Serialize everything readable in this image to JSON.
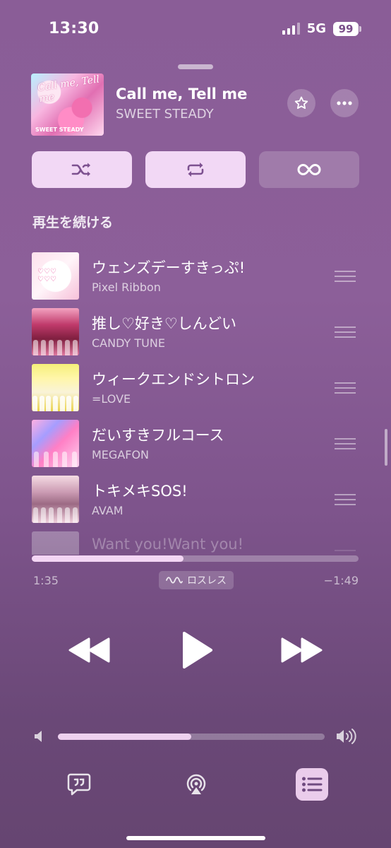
{
  "status_bar": {
    "time": "13:30",
    "network": "5G",
    "battery": "99"
  },
  "now_playing": {
    "title": "Call me, Tell me",
    "artist": "SWEET STEADY",
    "artwork_text": "Call me, Tell me",
    "artwork_subtext": "SWEET STEADY",
    "favorite_icon": "star-icon",
    "more_icon": "ellipsis-icon"
  },
  "modes": [
    {
      "name": "shuffle",
      "icon": "shuffle-icon",
      "active": true
    },
    {
      "name": "repeat",
      "icon": "repeat-icon",
      "active": true
    },
    {
      "name": "autoplay",
      "icon": "infinity-icon",
      "active": false
    }
  ],
  "queue": {
    "section_title": "再生を続ける",
    "items": [
      {
        "title": "ウェンズデーすきっぷ!",
        "artist": "Pixel Ribbon"
      },
      {
        "title": "推し♡好き♡しんどい",
        "artist": "CANDY TUNE"
      },
      {
        "title": "ウィークエンドシトロン",
        "artist": "=LOVE"
      },
      {
        "title": "だいすきフルコース",
        "artist": "MEGAFON"
      },
      {
        "title": "トキメキSOS!",
        "artist": "AVAM"
      },
      {
        "title": "Want you!Want you!",
        "artist": ""
      }
    ]
  },
  "playback": {
    "elapsed": "1:35",
    "remaining": "−1:49",
    "progress_fraction": 0.465,
    "quality_badge": "ロスレス"
  },
  "volume": {
    "level_fraction": 0.5
  },
  "bottom_actions": {
    "lyrics_icon": "lyrics-bubble-icon",
    "airplay_icon": "airplay-icon",
    "queue_icon": "queue-list-icon"
  },
  "colors": {
    "accent_pill": "#f8daf8",
    "background_top": "#8a5d97",
    "background_bottom": "#664571"
  }
}
